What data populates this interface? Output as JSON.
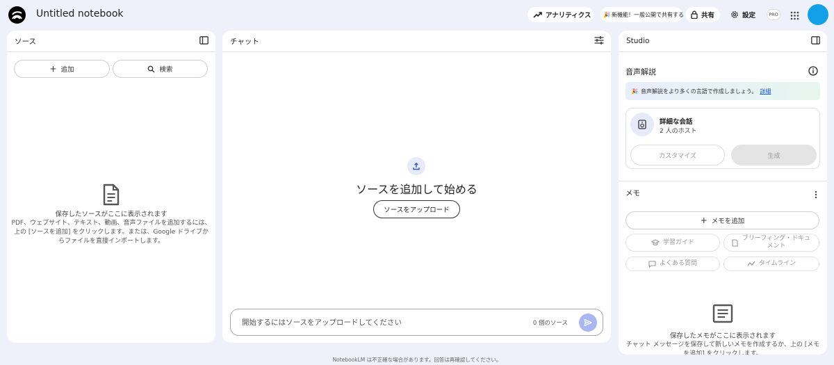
{
  "header": {
    "title": "Untitled notebook",
    "analytics_label": "アナリティクス",
    "new_feature_label": "新機能！一般公開で共有する",
    "share_label": "共有",
    "settings_label": "設定",
    "pro_badge": "PRO",
    "avatar_color": "#12a1e8"
  },
  "sources": {
    "title": "ソース",
    "add_label": "追加",
    "search_label": "検索",
    "empty_title": "保存したソースがここに表示されます",
    "empty_description": "PDF、ウェブサイト、テキスト、動画、音声ファイルを追加するには、上の [ソースを追加] をクリックします。または、Google ドライブからファイルを直接インポートします。"
  },
  "chat": {
    "title": "チャット",
    "headline": "ソースを追加して始める",
    "upload_label": "ソースをアップロード",
    "input_placeholder": "開始するにはソースをアップロードしてください",
    "source_count": "0 個のソース"
  },
  "studio": {
    "title": "Studio",
    "audio_overview_title": "音声解説",
    "banner_text": "音声解説をより多くの言語で作成しましょう。",
    "banner_link": "詳細",
    "card_title": "詳細な会話",
    "card_subtitle": "2 人のホスト",
    "customize_label": "カスタマイズ",
    "generate_label": "生成",
    "memo_title": "メモ",
    "add_memo_label": "メモを追加",
    "study_guide_label": "学習ガイド",
    "briefing_doc_label": "ブリーフィング・ドキュメント",
    "faq_label": "よくある質問",
    "timeline_label": "タイムライン",
    "memo_empty_title": "保存したメモがここに表示されます",
    "memo_empty_description": "チャット メッセージを保存して新しいメモを作成するか、上の [メモを追加] をクリックします。"
  },
  "footer": {
    "disclaimer": "NotebookLM は不正確な場合があります。回答は再確認してください。"
  }
}
